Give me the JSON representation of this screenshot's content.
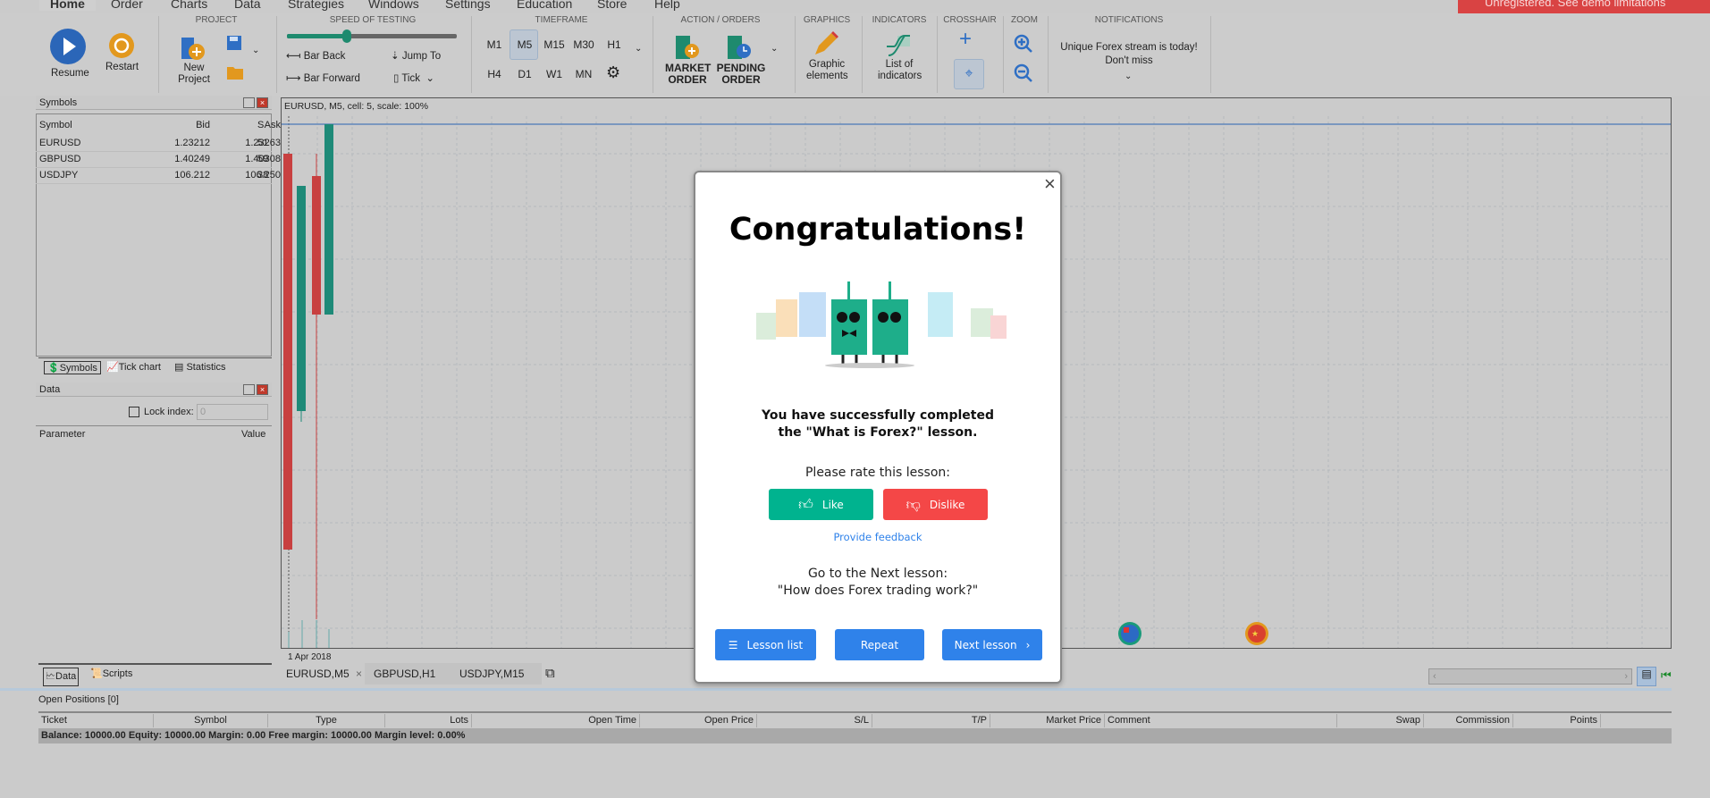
{
  "menu": {
    "tabs": [
      "Home",
      "Order",
      "Charts",
      "Data",
      "Strategies",
      "Windows",
      "Settings",
      "Education",
      "Store",
      "Help"
    ],
    "banner": "Unregistered. See demo limitations"
  },
  "ribbon": {
    "resume": "Resume",
    "restart": "Restart",
    "project": {
      "header": "PROJECT",
      "new_project": "New Project"
    },
    "speed": {
      "header": "SPEED OF TESTING",
      "bar_back": "Bar Back",
      "bar_forward": "Bar Forward",
      "jump_to": "Jump To",
      "tick": "Tick",
      "slider_value": 0.35
    },
    "timeframe": {
      "header": "TIMEFRAME",
      "row1": [
        "M1",
        "M5",
        "M15",
        "M30",
        "H1"
      ],
      "row2": [
        "H4",
        "D1",
        "W1",
        "MN"
      ],
      "selected": "M5"
    },
    "orders": {
      "header": "ACTION / ORDERS",
      "market": "MARKET ORDER",
      "pending": "PENDING ORDER"
    },
    "graphics": {
      "header": "GRAPHICS",
      "label": "Graphic elements"
    },
    "indicators": {
      "header": "INDICATORS",
      "label": "List of indicators"
    },
    "crosshair": {
      "header": "CROSSHAIR"
    },
    "zoom": {
      "header": "ZOOM"
    },
    "notifications": {
      "header": "NOTIFICATIONS",
      "text1": "Unique Forex stream is today!",
      "text2": "Don't miss"
    }
  },
  "symbols_panel": {
    "title": "Symbols",
    "columns": [
      "Symbol",
      "Bid",
      "Ask",
      "S"
    ],
    "rows": [
      [
        "EURUSD",
        "1.23212",
        "1.23263",
        "51"
      ],
      [
        "GBPUSD",
        "1.40249",
        "1.40308",
        "59"
      ],
      [
        "USDJPY",
        "106.212",
        "106.250",
        "38"
      ]
    ],
    "tabs": [
      "Symbols",
      "Tick chart",
      "Statistics"
    ]
  },
  "data_panel": {
    "title": "Data",
    "lock_index": "Lock index:",
    "lock_value": "0",
    "columns": [
      "Parameter",
      "Value"
    ],
    "tabs": [
      "Data",
      "Scripts"
    ]
  },
  "chart": {
    "info": "EURUSD, M5, cell: 5, scale: 100%",
    "date_label": "1 Apr 2018",
    "tabs": [
      "EURUSD,M5",
      "GBPUSD,H1",
      "USDJPY,M15"
    ],
    "close": "×"
  },
  "positions": {
    "title": "Open Positions [0]",
    "columns": [
      "Ticket",
      "Symbol",
      "Type",
      "Lots",
      "Open Time",
      "Open Price",
      "S/L",
      "T/P",
      "Market Price",
      "Comment",
      "Swap",
      "Commission",
      "Points"
    ],
    "balance": "Balance: 10000.00 Equity: 10000.00 Margin: 0.00 Free margin: 10000.00 Margin level: 0.00%"
  },
  "modal": {
    "title": "Congratulations!",
    "line1": "You have successfully completed",
    "line2": "the \"What is Forex?\" lesson.",
    "rate": "Please rate this lesson:",
    "like": "Like",
    "dislike": "Dislike",
    "feedback": "Provide feedback",
    "next1": "Go to the Next lesson:",
    "next2": "\"How does Forex trading work?\"",
    "lesson_list": "Lesson list",
    "repeat": "Repeat",
    "next_lesson": "Next lesson",
    "close": "×"
  },
  "colors": {
    "bull": "#1e8a78",
    "bear": "#c84040",
    "like": "#00b38f",
    "dislike": "#f44747",
    "primary": "#2f82ea",
    "link": "#2f82ea"
  }
}
